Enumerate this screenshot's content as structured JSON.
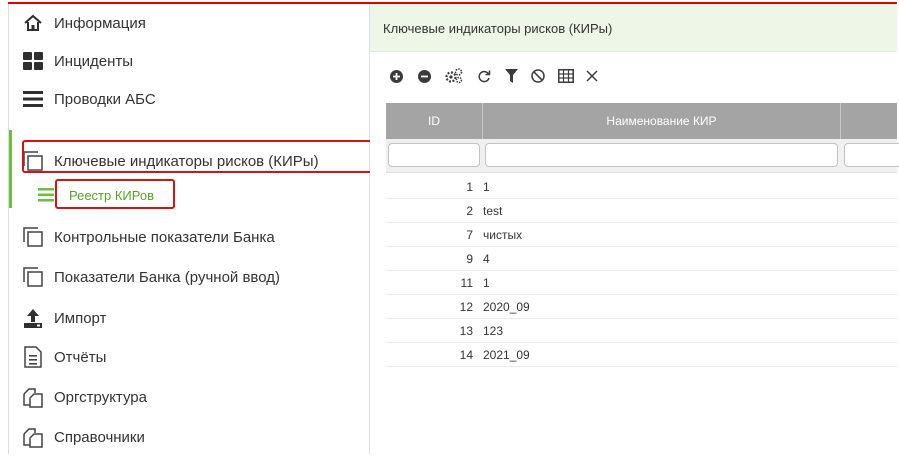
{
  "sidebar": {
    "items": [
      {
        "label": "Информация",
        "icon": "home-icon"
      },
      {
        "label": "Инциденты",
        "icon": "dashboard-icon"
      },
      {
        "label": "Проводки АБС",
        "icon": "menu-lines-icon"
      },
      {
        "label": "Ключевые индикаторы рисков (КИРы)",
        "icon": "copy-icon"
      },
      {
        "label": "Контрольные показатели Банка",
        "icon": "copy-icon"
      },
      {
        "label": "Показатели Банка (ручной ввод)",
        "icon": "copy-icon"
      },
      {
        "label": "Импорт",
        "icon": "upload-icon"
      },
      {
        "label": "Отчёты",
        "icon": "document-icon"
      },
      {
        "label": "Оргструктура",
        "icon": "files-icon"
      },
      {
        "label": "Справочники",
        "icon": "files-icon"
      }
    ],
    "subitem": {
      "label": "Реестр КИРов",
      "icon": "list-icon"
    },
    "accent_color": "#6abf3e",
    "highlight_color": "#d11414"
  },
  "main": {
    "breadcrumb": "Ключевые индикаторы рисков (КИРы)",
    "toolbar": [
      {
        "name": "add-icon"
      },
      {
        "name": "remove-icon"
      },
      {
        "name": "settings-icon"
      },
      {
        "name": "refresh-icon"
      },
      {
        "name": "filter-icon"
      },
      {
        "name": "clear-filter-icon"
      },
      {
        "name": "columns-icon"
      },
      {
        "name": "close-icon"
      }
    ],
    "grid": {
      "columns": [
        "ID",
        "Наименование КИР",
        ""
      ],
      "rows": [
        {
          "id": "1",
          "name": "1"
        },
        {
          "id": "2",
          "name": "test"
        },
        {
          "id": "7",
          "name": "чистых"
        },
        {
          "id": "9",
          "name": "4"
        },
        {
          "id": "11",
          "name": "1"
        },
        {
          "id": "12",
          "name": "2020_09"
        },
        {
          "id": "13",
          "name": "123"
        },
        {
          "id": "14",
          "name": "2021_09"
        }
      ]
    }
  }
}
